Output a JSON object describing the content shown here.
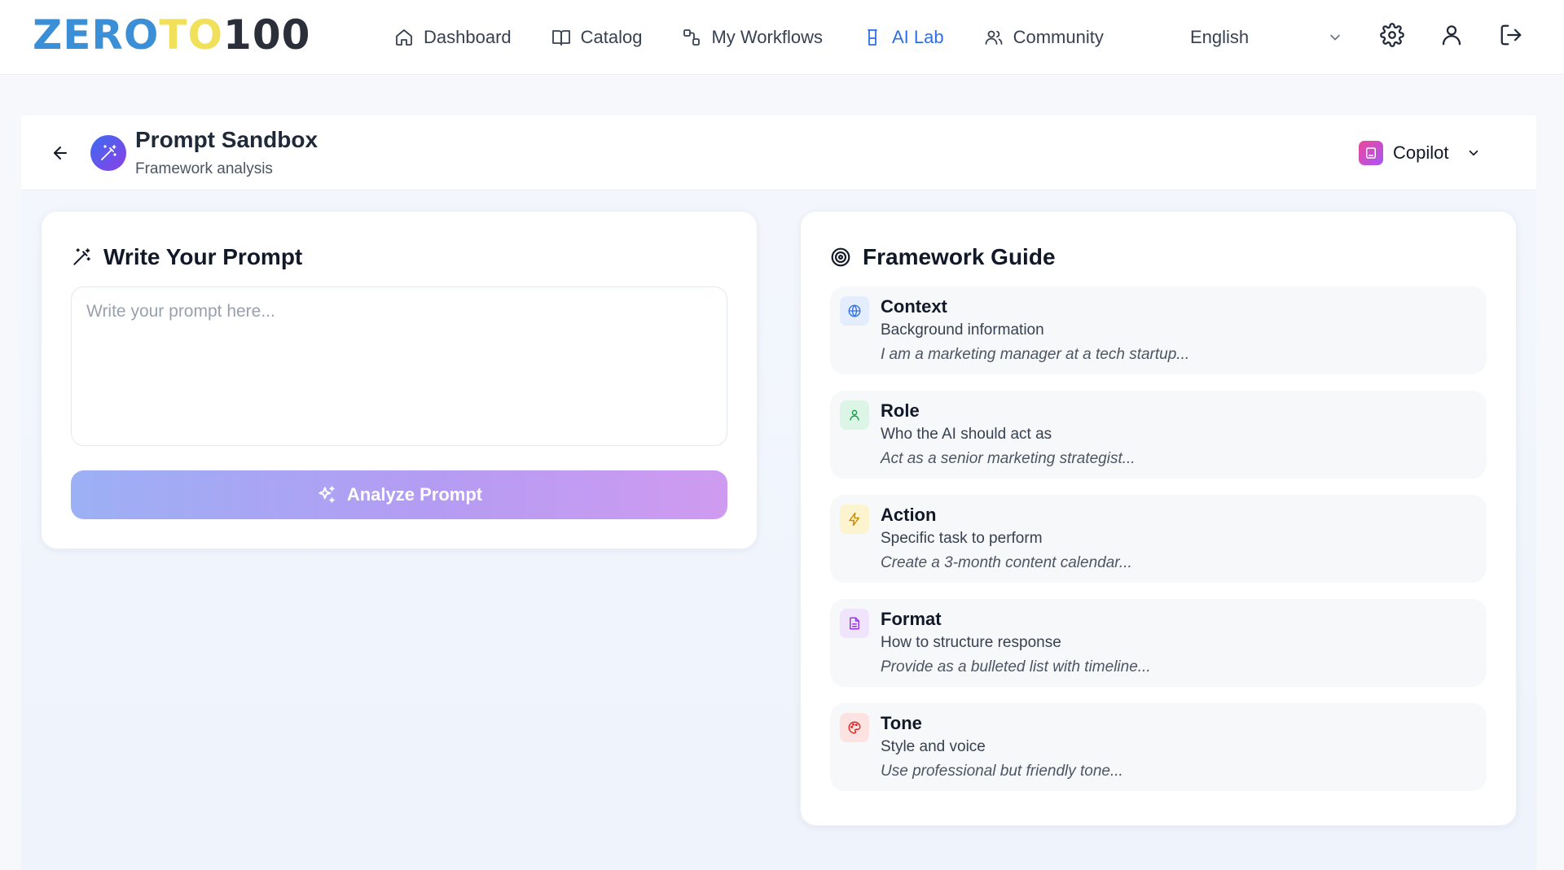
{
  "logo": {
    "part1": "ZERO",
    "part2": "TO",
    "part3": "100"
  },
  "nav": {
    "items": [
      {
        "label": "Dashboard",
        "icon": "home-icon"
      },
      {
        "label": "Catalog",
        "icon": "book-icon"
      },
      {
        "label": "My Workflows",
        "icon": "workflow-icon"
      },
      {
        "label": "AI Lab",
        "icon": "flask-icon",
        "active": true
      },
      {
        "label": "Community",
        "icon": "users-icon"
      }
    ],
    "language": "English",
    "icons": [
      "gear-icon",
      "user-icon",
      "logout-icon"
    ]
  },
  "header": {
    "title": "Prompt Sandbox",
    "subtitle": "Framework analysis",
    "model": "Copilot"
  },
  "prompt": {
    "title": "Write Your Prompt",
    "value": "",
    "placeholder": "Write your prompt here...",
    "button_label": "Analyze Prompt"
  },
  "guide": {
    "title": "Framework Guide",
    "items": [
      {
        "name": "Context",
        "desc": "Background information",
        "example": "I am a marketing manager at a tech startup...",
        "icon": "globe-icon"
      },
      {
        "name": "Role",
        "desc": "Who the AI should act as",
        "example": "Act as a senior marketing strategist...",
        "icon": "person-icon"
      },
      {
        "name": "Action",
        "desc": "Specific task to perform",
        "example": "Create a 3-month content calendar...",
        "icon": "lightning-icon"
      },
      {
        "name": "Format",
        "desc": "How to structure response",
        "example": "Provide as a bulleted list with timeline...",
        "icon": "document-icon"
      },
      {
        "name": "Tone",
        "desc": "Style and voice",
        "example": "Use professional but friendly tone...",
        "icon": "palette-icon"
      }
    ]
  },
  "colors": {
    "accent": "#2f6fe4",
    "logo_blue": "#3b8fd6",
    "logo_yellow": "#f1e05a",
    "logo_dark": "#2b2f3a",
    "button_gradient_start": "#9cb0f5",
    "button_gradient_end": "#cf9bf0"
  }
}
